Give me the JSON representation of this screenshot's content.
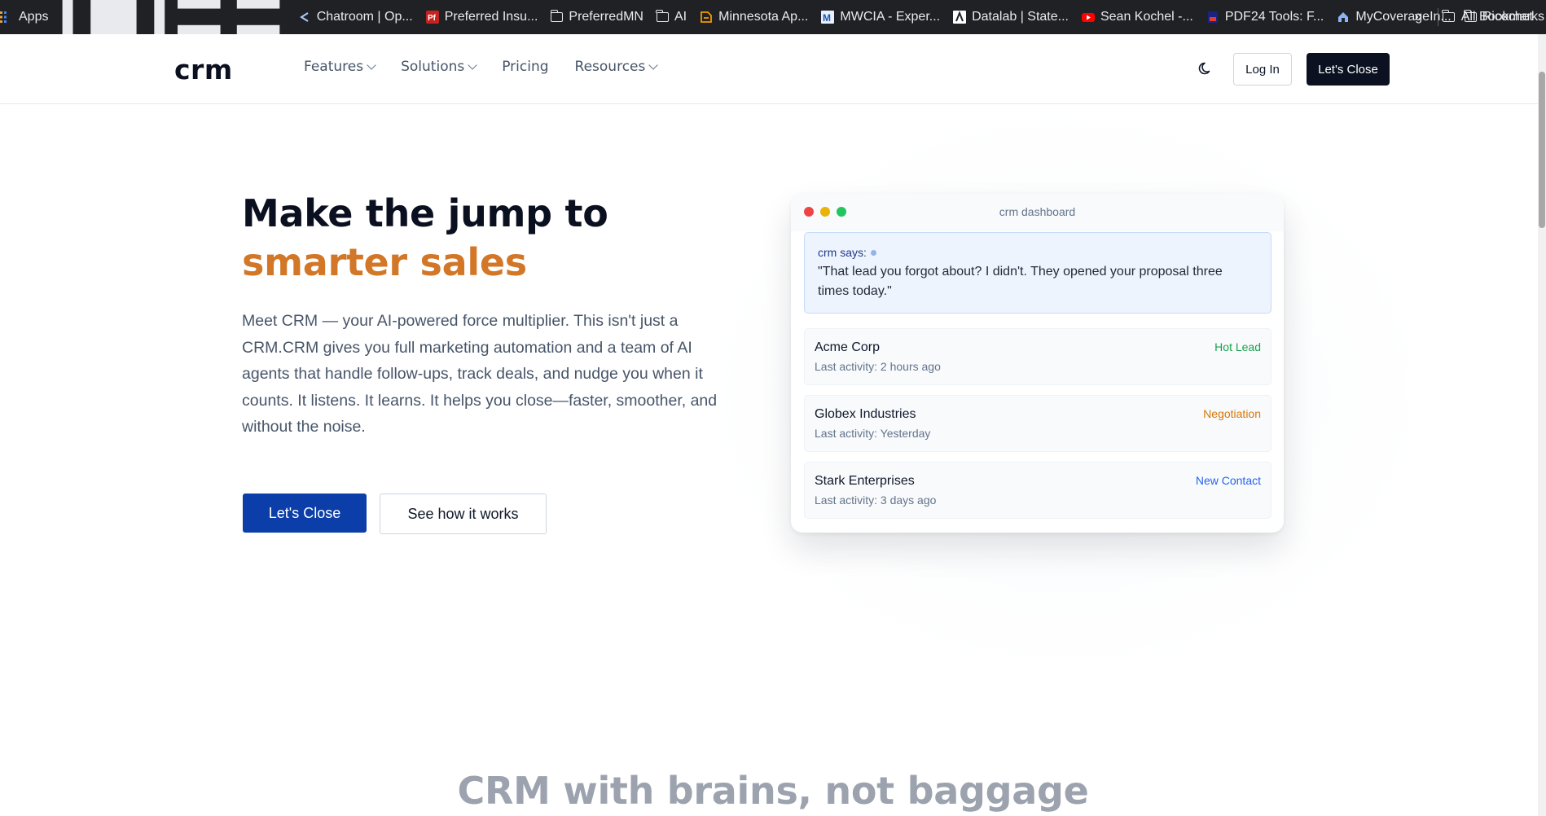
{
  "bookmarks": {
    "apps_label": "Apps",
    "items": [
      {
        "label": "Chatroom | Op...",
        "icon": "chat-icon"
      },
      {
        "label": "Preferred Insu...",
        "icon": "pf-logo-icon"
      },
      {
        "label": "PreferredMN",
        "icon": "folder-icon"
      },
      {
        "label": "AI",
        "icon": "folder-icon"
      },
      {
        "label": "Minnesota Ap...",
        "icon": "orange-doc-icon"
      },
      {
        "label": "MWCIA - Exper...",
        "icon": "m-logo-icon"
      },
      {
        "label": "Datalab | State...",
        "icon": "datalab-icon"
      },
      {
        "label": "Sean Kochel -...",
        "icon": "youtube-icon"
      },
      {
        "label": "PDF24 Tools: F...",
        "icon": "pdf24-icon"
      },
      {
        "label": "MyCoverageIn...",
        "icon": "house-icon"
      },
      {
        "label": "Ricochet",
        "icon": "folder-icon"
      }
    ],
    "more_label": "»",
    "all_label": "All Bookmarks"
  },
  "header": {
    "logo": "crm",
    "nav": [
      {
        "label": "Features",
        "dropdown": true
      },
      {
        "label": "Solutions",
        "dropdown": true
      },
      {
        "label": "Pricing",
        "dropdown": false
      },
      {
        "label": "Resources",
        "dropdown": true
      }
    ],
    "login_label": "Log In",
    "cta_label": "Let's Close"
  },
  "hero": {
    "title_line1": "Make the jump to",
    "title_line2": "smarter sales",
    "description": "Meet CRM — your AI-powered force multiplier. This isn't just a CRM.CRM gives you full marketing automation and a team of AI agents that handle follow-ups, track deals, and nudge you when it counts. It listens. It learns. It helps you close—faster, smoother, and without the noise.",
    "primary_cta": "Let's Close",
    "secondary_cta": "See how it works"
  },
  "dashboard": {
    "title": "crm dashboard",
    "says_label": "crm says:",
    "says_text": "\"That lead you forgot about? I didn't. They opened your proposal three times today.\"",
    "leads": [
      {
        "name": "Acme Corp",
        "activity": "Last activity: 2 hours ago",
        "status": "Hot Lead",
        "status_color": "#16a34a"
      },
      {
        "name": "Globex Industries",
        "activity": "Last activity: Yesterday",
        "status": "Negotiation",
        "status_color": "#d97706"
      },
      {
        "name": "Stark Enterprises",
        "activity": "Last activity: 3 days ago",
        "status": "New Contact",
        "status_color": "#2563eb"
      }
    ]
  },
  "section": {
    "title": "CRM with brains, not baggage"
  },
  "colors": {
    "accent": "#d27728",
    "primary_button": "#0b3ea8",
    "dark_button": "#0b1120"
  }
}
